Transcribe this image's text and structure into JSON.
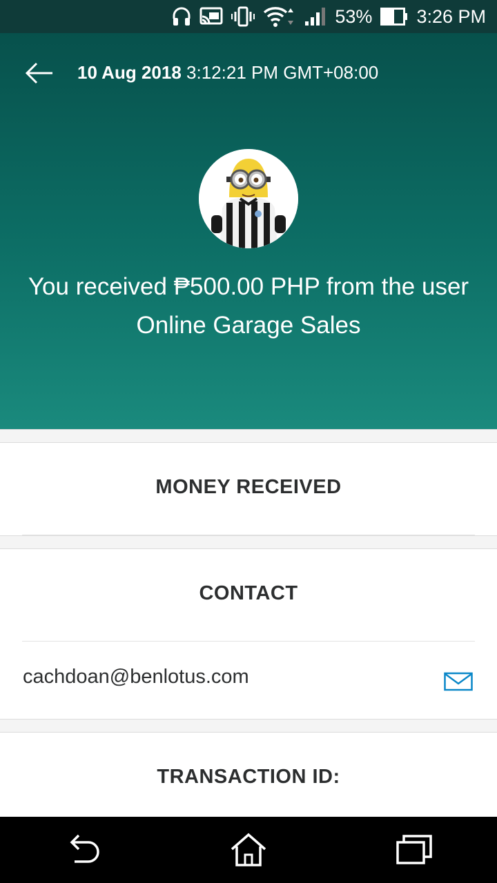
{
  "status_bar": {
    "battery_percent": "53%",
    "time": "3:26 PM",
    "icons": [
      "headphones-icon",
      "cast-icon",
      "vibrate-icon",
      "wifi-icon",
      "signal-icon",
      "battery-icon"
    ]
  },
  "header": {
    "date": "10 Aug 2018",
    "time": "3:12:21 PM GMT+08:00",
    "headline": "You received ₱500.00 PHP from the user Online Garage Sales",
    "gradient_top": "#07514c",
    "gradient_bottom": "#1a8a7d"
  },
  "sections": {
    "money_received": "MONEY RECEIVED",
    "contact": "CONTACT",
    "transaction_id": "TRANSACTION ID:"
  },
  "contact": {
    "email": "cachdoan@benlotus.com",
    "action_icon": "mail-icon",
    "accent": "#0a87c8"
  },
  "nav_bar": {
    "icons": [
      "back-nav-icon",
      "home-icon",
      "recents-icon"
    ]
  }
}
